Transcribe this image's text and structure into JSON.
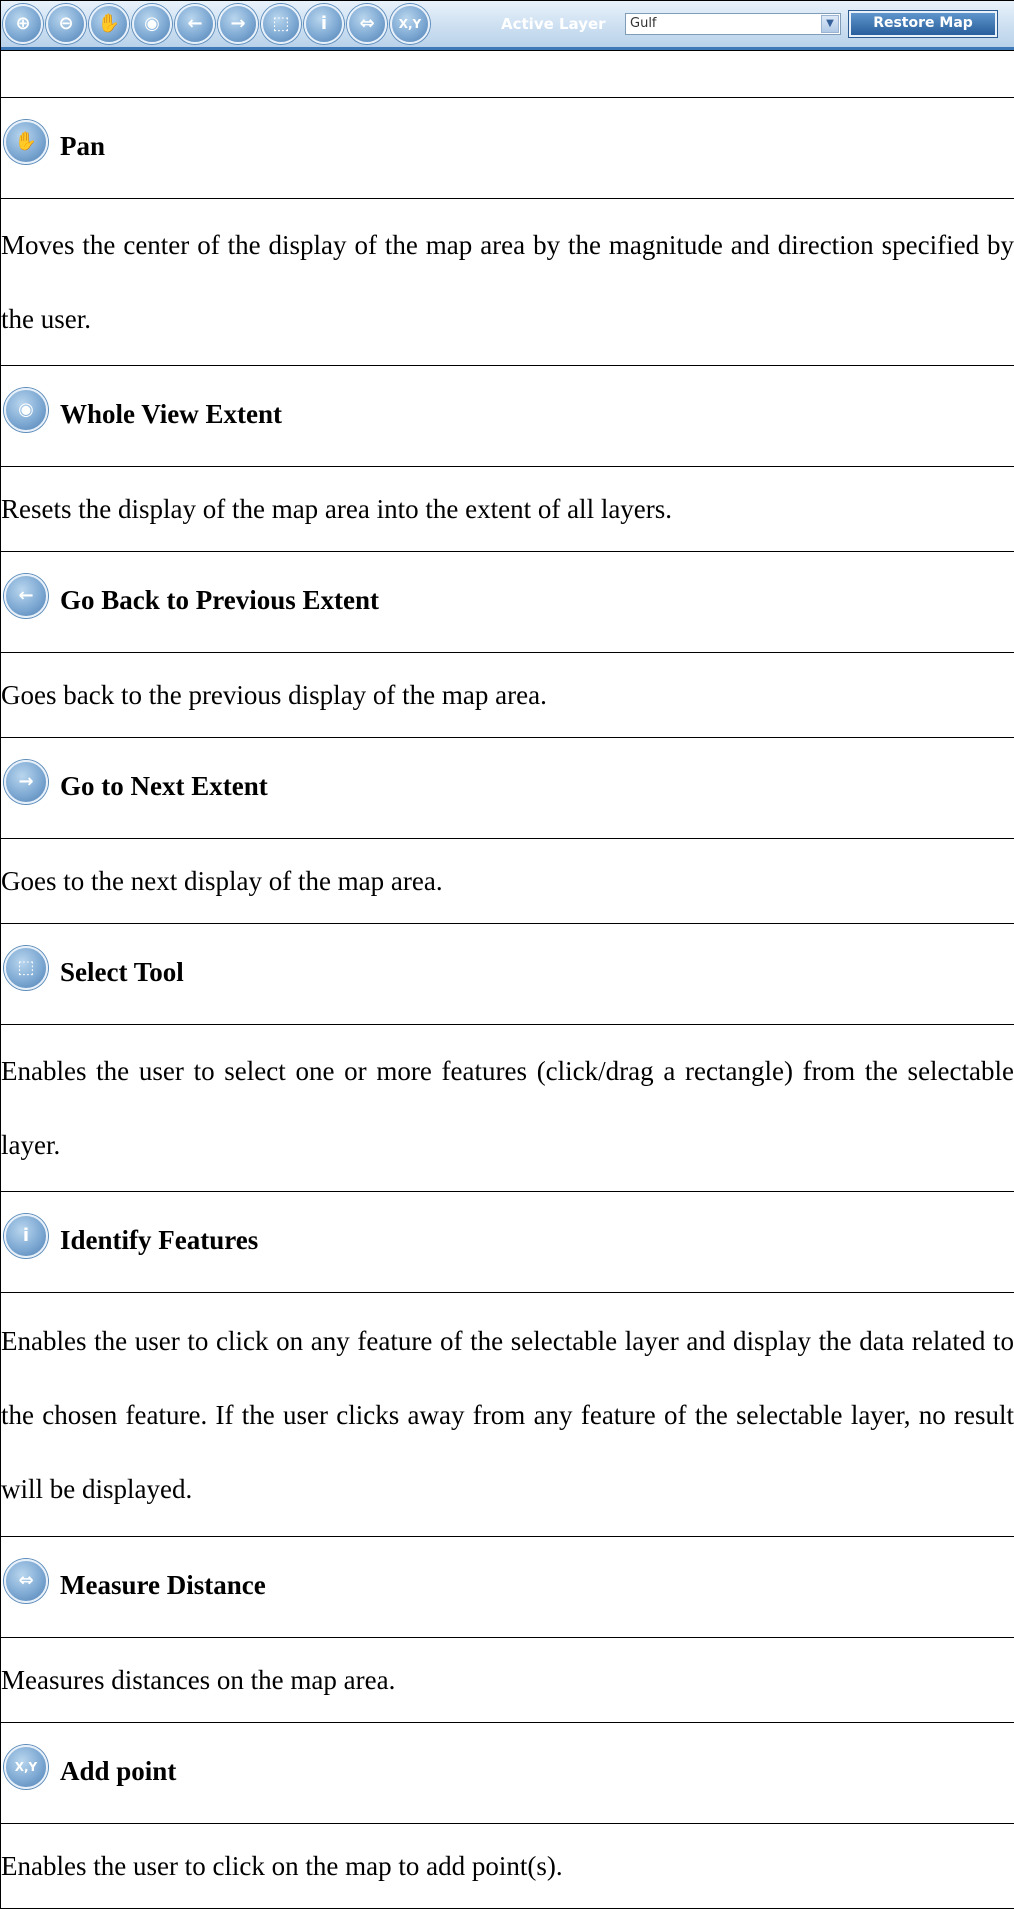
{
  "toolbar": {
    "tools": [
      {
        "icon": "zoom-in-icon",
        "glyph": "⊕"
      },
      {
        "icon": "zoom-out-icon",
        "glyph": "⊖"
      },
      {
        "icon": "pan-hand-icon",
        "glyph": "✋"
      },
      {
        "icon": "whole-view-globe-icon",
        "glyph": "◉"
      },
      {
        "icon": "back-arrow-icon",
        "glyph": "←"
      },
      {
        "icon": "forward-arrow-icon",
        "glyph": "→"
      },
      {
        "icon": "select-rectangle-icon",
        "glyph": "⬚"
      },
      {
        "icon": "identify-info-icon",
        "glyph": "i"
      },
      {
        "icon": "measure-ruler-icon",
        "glyph": "⇔"
      },
      {
        "icon": "xy-point-icon",
        "glyph": "X,Y"
      }
    ],
    "active_layer_label": "Active Layer",
    "active_layer_value": "Gulf",
    "restore_label": "Restore Map"
  },
  "sections": [
    {
      "icon": "pan-hand-icon",
      "glyph": "✋",
      "title": "Pan",
      "description": "Moves the center of the display of the map area by the magnitude and direction specified by the user."
    },
    {
      "icon": "whole-view-globe-icon",
      "glyph": "◉",
      "title": "Whole View Extent",
      "description": "Resets the display of the map area into the extent of all layers."
    },
    {
      "icon": "back-arrow-icon",
      "glyph": "←",
      "title": "Go Back to Previous Extent",
      "description": "Goes back to the previous display of the map area."
    },
    {
      "icon": "forward-arrow-icon",
      "glyph": "→",
      "title": "Go to Next Extent",
      "description": "Goes to the next display of the map area."
    },
    {
      "icon": "select-rectangle-icon",
      "glyph": "⬚",
      "title": "Select Tool",
      "description": "Enables the user to select one or more features (click/drag a rectangle) from the selectable layer."
    },
    {
      "icon": "identify-info-icon",
      "glyph": "i",
      "title": "Identify Features",
      "description": "Enables the user to click on any feature of the selectable layer and display the data related to the chosen feature. If the user clicks away from any feature of the selectable layer, no result will be displayed."
    },
    {
      "icon": "measure-ruler-icon",
      "glyph": "⇔",
      "title": "Measure Distance",
      "description": "Measures distances on the map area."
    },
    {
      "icon": "xy-point-icon",
      "glyph": "X,Y",
      "title": "Add point",
      "description": "Enables the user to click on the map to add point(s)."
    }
  ]
}
